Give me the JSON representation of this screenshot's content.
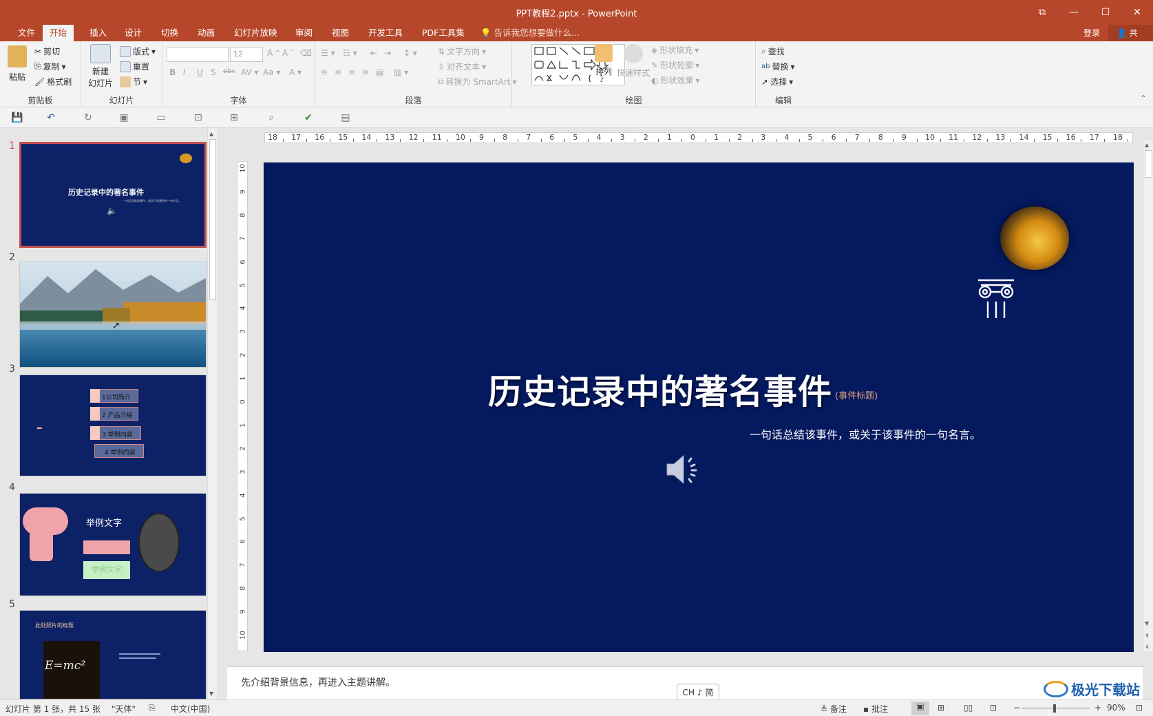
{
  "window": {
    "title": "PPT教程2.pptx - PowerPoint",
    "restore_glyph": "⧉",
    "minimize_glyph": "—",
    "maximize_glyph": "☐",
    "close_glyph": "✕"
  },
  "tabs": [
    "文件",
    "开始",
    "插入",
    "设计",
    "切换",
    "动画",
    "幻灯片放映",
    "审阅",
    "视图",
    "开发工具",
    "PDF工具集"
  ],
  "active_tab": "开始",
  "tell_me": "告诉我您想要做什么...",
  "account": {
    "login": "登录",
    "share": "共享"
  },
  "ribbon": {
    "clipboard": {
      "label": "剪贴板",
      "paste": "粘贴",
      "cut": "剪切",
      "copy": "复制",
      "format_painter": "格式刷"
    },
    "slides": {
      "label": "幻灯片",
      "new_slide_1": "新建",
      "new_slide_2": "幻灯片",
      "layout": "版式",
      "reset": "重置",
      "section": "节"
    },
    "font": {
      "label": "字体",
      "font_name": "",
      "font_size": "12"
    },
    "paragraph": {
      "label": "段落",
      "text_direction": "文字方向",
      "align_text": "对齐文本",
      "smartart": "转换为 SmartArt"
    },
    "drawing": {
      "label": "绘图",
      "arrange": "排列",
      "quick_styles": "快速样式",
      "shape_fill": "形状填充",
      "shape_outline": "形状轮廓",
      "shape_effects": "形状效果"
    },
    "editing": {
      "label": "编辑",
      "find": "查找",
      "replace": "替换",
      "select": "选择"
    }
  },
  "thumbnails": [
    {
      "num": "1",
      "title": "历史记录中的著名事件",
      "subtitle": "一句话总结该事件，或关于该事件的一句名言。"
    },
    {
      "num": "2"
    },
    {
      "num": "3",
      "items": [
        "1公司简介",
        "2 产品介绍",
        "3  举例内容",
        "4  举例内容"
      ]
    },
    {
      "num": "4",
      "title": "举例文字",
      "box_text": "举例文字"
    },
    {
      "num": "5",
      "title": "此处照片的标题",
      "formula": "E=mc²"
    }
  ],
  "ruler": {
    "h_labels": [
      "18",
      "17",
      "16",
      "15",
      "14",
      "13",
      "12",
      "11",
      "10",
      "9",
      "8",
      "7",
      "6",
      "5",
      "4",
      "3",
      "2",
      "1",
      "0",
      "1",
      "2",
      "3",
      "4",
      "5",
      "6",
      "7",
      "8",
      "9",
      "10",
      "11",
      "12",
      "13",
      "14",
      "15",
      "16",
      "17",
      "18"
    ],
    "v_labels": [
      "10",
      "9",
      "8",
      "7",
      "6",
      "5",
      "4",
      "3",
      "2",
      "1",
      "0",
      "1",
      "2",
      "3",
      "4",
      "5",
      "6",
      "7",
      "8",
      "9",
      "10"
    ]
  },
  "slide": {
    "title": "历史记录中的著名事件",
    "title_tag": "(事件标题)",
    "subtitle": "一句话总结该事件，或关于该事件的一句名言。",
    "background": "#04195e"
  },
  "notes": "先介绍背景信息，再进入主题讲解。",
  "ime": "CH ♪ 简",
  "status": {
    "slide_info": "幻灯片 第 1 张，共 15 张",
    "theme": "\"天体\"",
    "language": "中文(中国)",
    "notes_btn": "备注",
    "comments_btn": "批注",
    "zoom": "90%"
  },
  "watermark": "极光下载站"
}
